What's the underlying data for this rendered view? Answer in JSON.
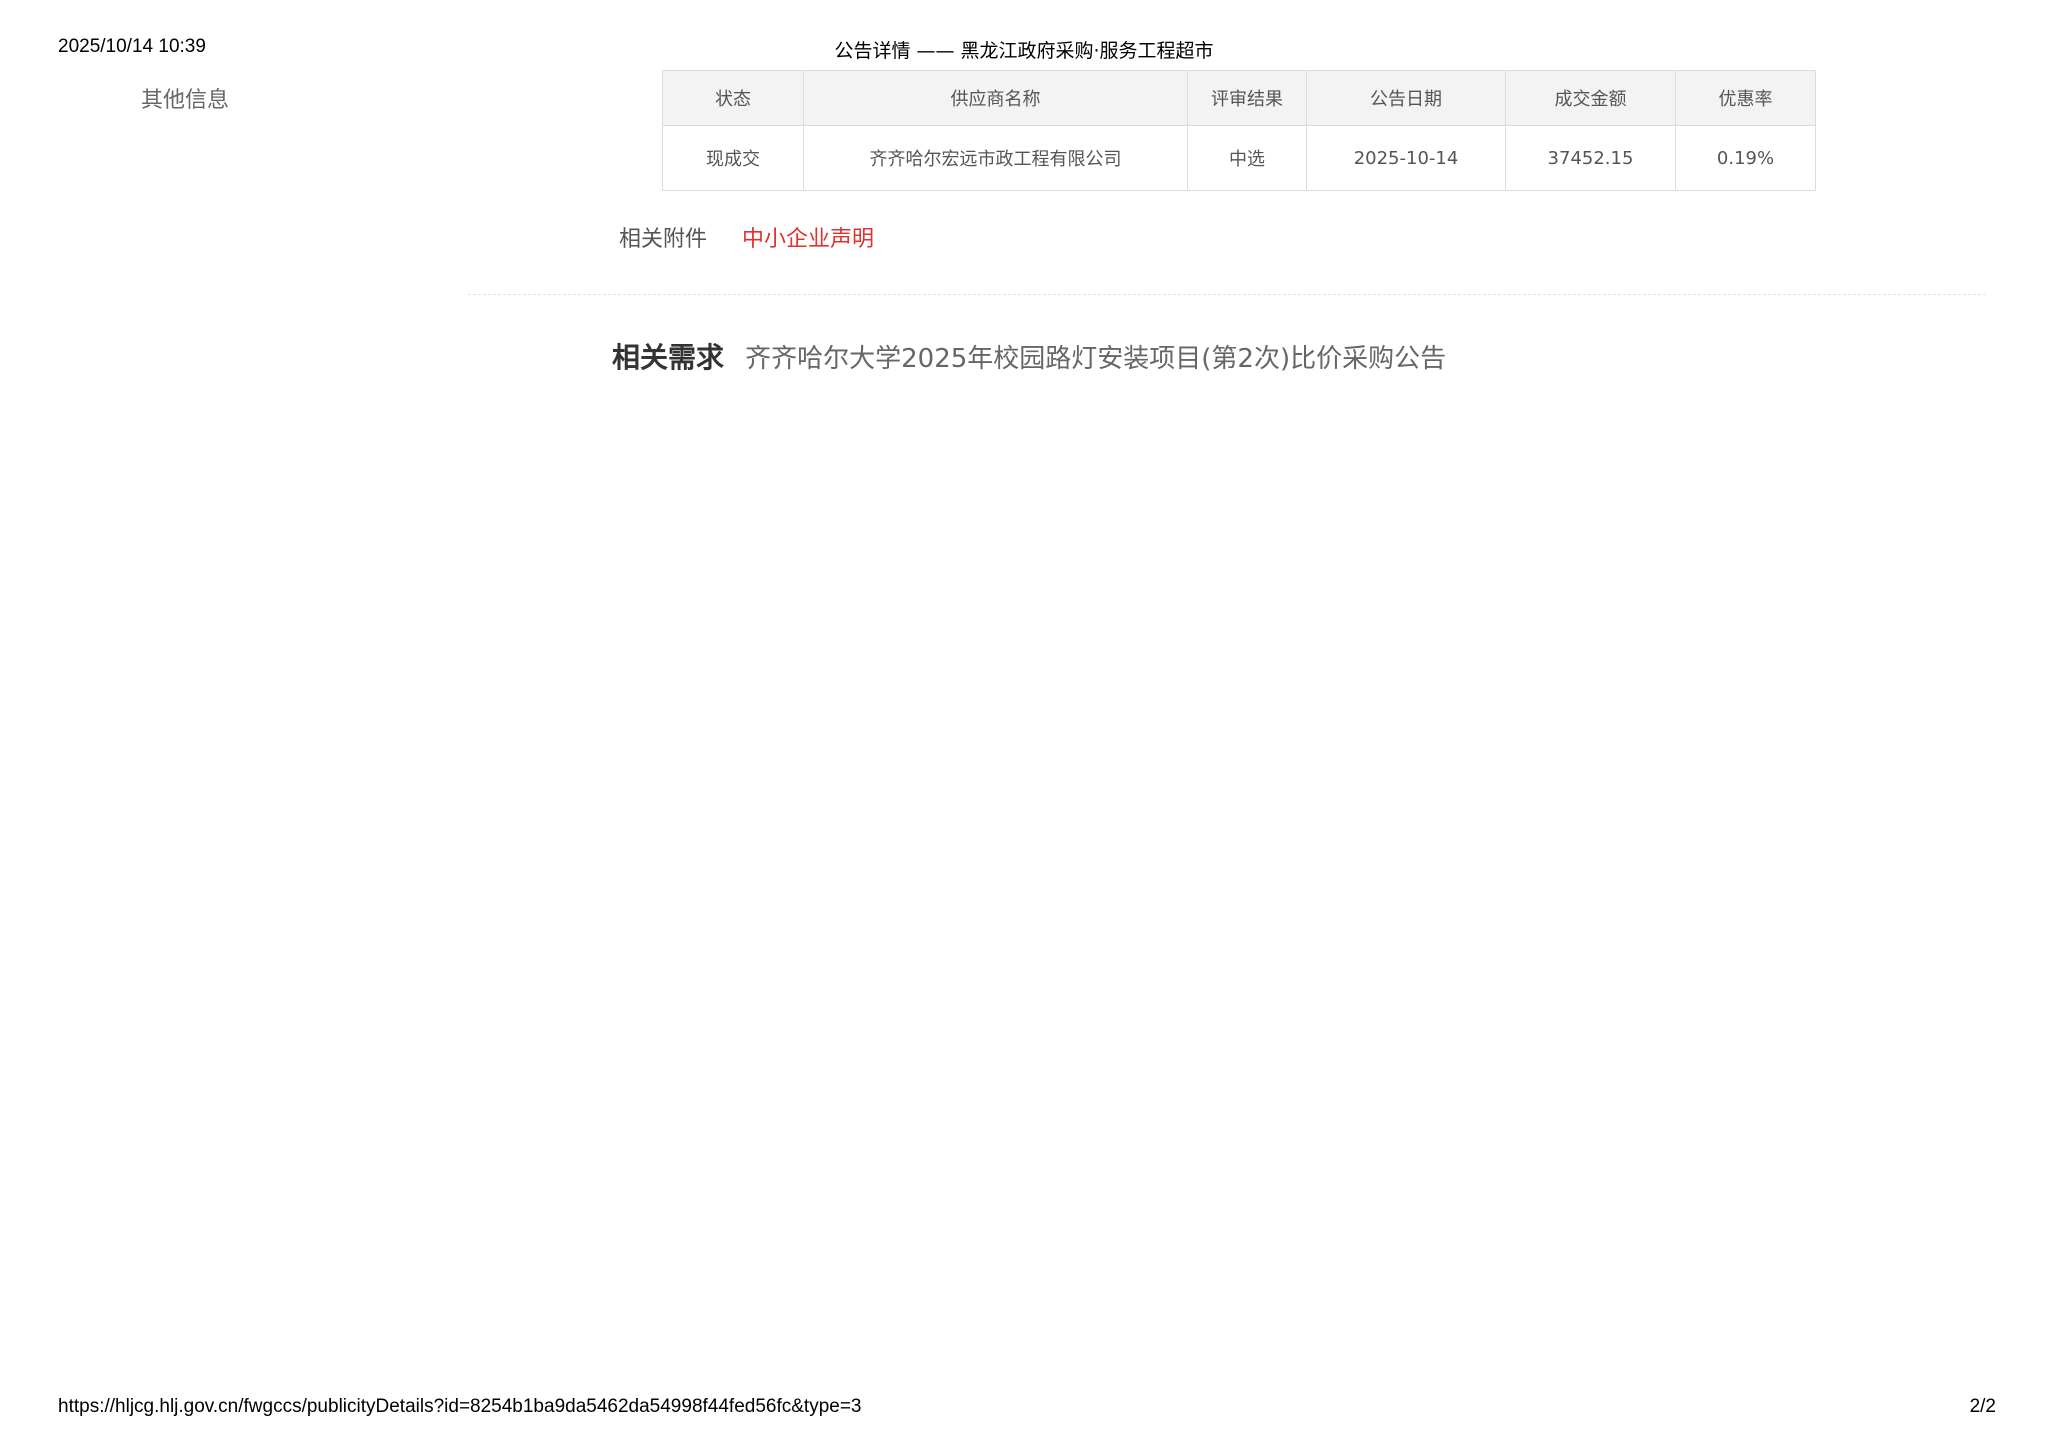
{
  "print_header": {
    "datetime": "2025/10/14 10:39",
    "title": "公告详情 —— 黑龙江政府采购·服务工程超市"
  },
  "sidebar": {
    "label": "其他信息"
  },
  "result_table": {
    "headers": [
      "状态",
      "供应商名称",
      "评审结果",
      "公告日期",
      "成交金额",
      "优惠率"
    ],
    "rows": [
      [
        "现成交",
        "齐齐哈尔宏远市政工程有限公司",
        "中选",
        "2025-10-14",
        "37452.15",
        "0.19%"
      ]
    ]
  },
  "attachments": {
    "label": "相关附件",
    "link": "中小企业声明"
  },
  "related": {
    "label": "相关需求",
    "link": "齐齐哈尔大学2025年校园路灯安装项目(第2次)比价采购公告"
  },
  "print_footer": {
    "url": "https://hljcg.hlj.gov.cn/fwgccs/publicityDetails?id=8254b1ba9da5462da54998f44fed56fc&type=3",
    "page": "2/2"
  },
  "colors": {
    "link_red": "#e0322e",
    "header_bg": "#f3f3f3",
    "border": "#dcdcdc"
  }
}
